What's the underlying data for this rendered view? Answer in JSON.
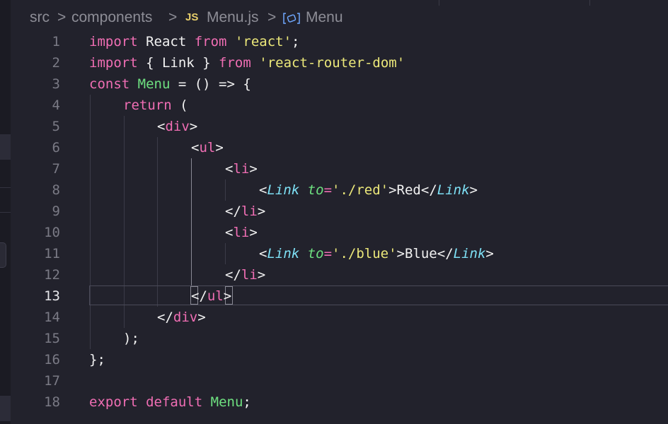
{
  "breadcrumb": {
    "items": [
      "src",
      "components",
      "Menu.js",
      "Menu"
    ],
    "separator": ">",
    "file_icon": "JS",
    "symbol_icon": "symbol-module-icon"
  },
  "gutter": {
    "line_numbers": [
      "1",
      "2",
      "3",
      "4",
      "5",
      "6",
      "7",
      "8",
      "9",
      "10",
      "11",
      "12",
      "13",
      "14",
      "15",
      "16",
      "17",
      "18"
    ],
    "active_line": "13"
  },
  "code": {
    "l1": {
      "kw1": "import",
      "t1": " React ",
      "kw2": "from",
      "t2": " ",
      "str": "'react'",
      "end": ";"
    },
    "l2": {
      "kw1": "import",
      "t1": " { Link } ",
      "kw2": "from",
      "t2": " ",
      "str": "'react-router-dom'"
    },
    "l3": {
      "kw": "const",
      "sp": " ",
      "fn": "Menu",
      "rest": " = () => {"
    },
    "l4": {
      "kw": "return",
      "rest": " ("
    },
    "l5": {
      "open": "<",
      "tag": "div",
      "close": ">"
    },
    "l6": {
      "open": "<",
      "tag": "ul",
      "close": ">"
    },
    "l7": {
      "open": "<",
      "tag": "li",
      "close": ">"
    },
    "l8": {
      "open": "<",
      "cmp": "Link",
      "sp": " ",
      "attr": "to",
      "eq": "=",
      "str": "'./red'",
      "gt": ">",
      "text": "Red",
      "open2": "</",
      "cmp2": "Link",
      "close": ">"
    },
    "l9": {
      "open": "</",
      "tag": "li",
      "close": ">"
    },
    "l10": {
      "open": "<",
      "tag": "li",
      "close": ">"
    },
    "l11": {
      "open": "<",
      "cmp": "Link",
      "sp": " ",
      "attr": "to",
      "eq": "=",
      "str": "'./blue'",
      "gt": ">",
      "text": "Blue",
      "open2": "</",
      "cmp2": "Link",
      "close": ">"
    },
    "l12": {
      "open": "</",
      "tag": "li",
      "close": ">"
    },
    "l13": {
      "open": "</",
      "tag": "ul",
      "close": ">"
    },
    "l14": {
      "open": "</",
      "tag": "div",
      "close": ">"
    },
    "l15": {
      "rest": ");"
    },
    "l16": {
      "rest": "};"
    },
    "l17": {
      "rest": ""
    },
    "l18": {
      "kw1": "export",
      "sp1": " ",
      "kw2": "default",
      "sp2": " ",
      "fn": "Menu",
      "end": ";"
    }
  },
  "colors": {
    "background": "#22222c",
    "keyword": "#f06eb4",
    "function": "#6ee080",
    "string": "#ece87a",
    "component": "#7ee0f5",
    "text": "#f2f2f2",
    "line_number": "#7a7a85"
  }
}
